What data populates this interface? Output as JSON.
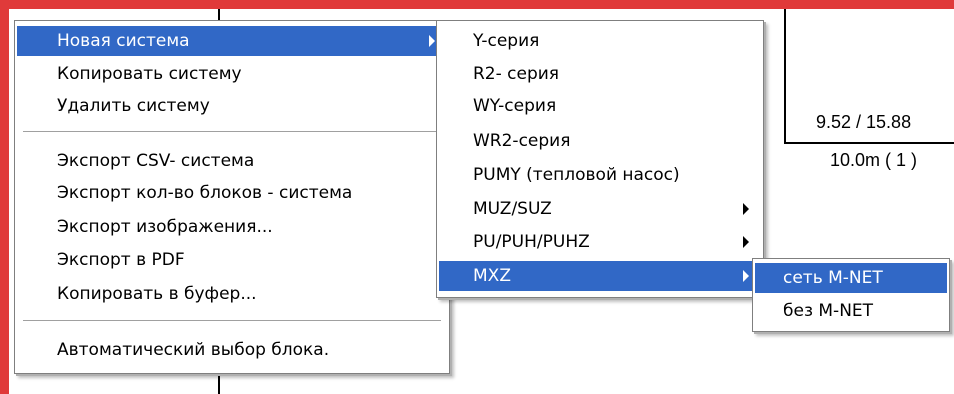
{
  "background": {
    "dim_label": "9.52 / 15.88",
    "length_label": "10.0m ( 1 )"
  },
  "main_menu": {
    "items": [
      {
        "label": "Новая система",
        "has_submenu": true,
        "selected": true
      },
      {
        "label": "Копировать систему"
      },
      {
        "label": "Удалить систему"
      },
      {
        "label": "Экспорт CSV- система"
      },
      {
        "label": "Экспорт кол-во блоков - система"
      },
      {
        "label": "Экспорт изображения..."
      },
      {
        "label": "Экспорт в PDF"
      },
      {
        "label": "Копировать в буфер..."
      },
      {
        "label": "Автоматический выбор блока."
      }
    ]
  },
  "series_menu": {
    "items": [
      {
        "label": "Y-серия"
      },
      {
        "label": "R2- серия"
      },
      {
        "label": "WY-серия"
      },
      {
        "label": "WR2-серия"
      },
      {
        "label": "PUMY  (тепловой насос)"
      },
      {
        "label": "MUZ/SUZ",
        "has_submenu": true
      },
      {
        "label": "PU/PUH/PUHZ",
        "has_submenu": true
      },
      {
        "label": "MXZ",
        "has_submenu": true,
        "selected": true
      }
    ]
  },
  "mxz_menu": {
    "items": [
      {
        "label": "сеть M-NET",
        "selected": true
      },
      {
        "label": "без M-NET"
      }
    ]
  },
  "colors": {
    "selection": "#3168c6",
    "frame": "#e03a3a"
  }
}
